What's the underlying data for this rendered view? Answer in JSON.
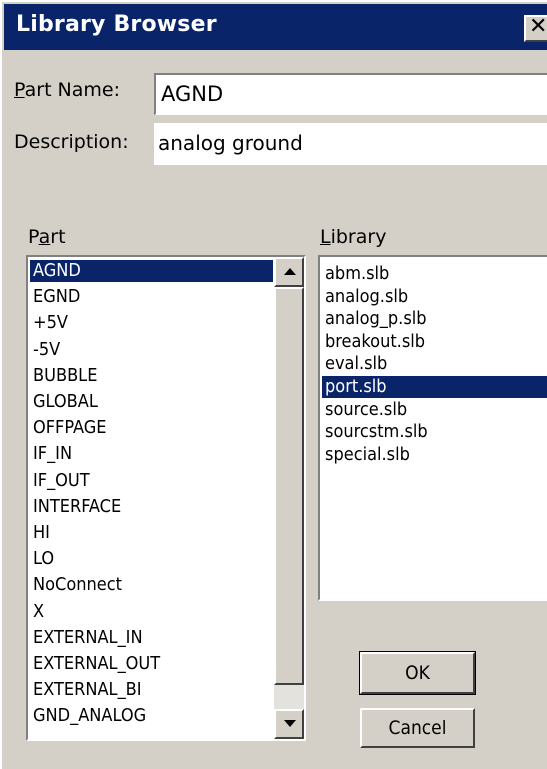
{
  "window": {
    "title": "Library Browser",
    "close_glyph": "✕"
  },
  "form": {
    "part_name_label": "Part Name:",
    "part_name_value": "AGND",
    "description_label": "Description:",
    "description_value": "analog ground"
  },
  "part": {
    "label": "Part",
    "items": [
      "AGND",
      "EGND",
      "+5V",
      "-5V",
      "BUBBLE",
      "GLOBAL",
      "OFFPAGE",
      "IF_IN",
      "IF_OUT",
      "INTERFACE",
      "HI",
      "LO",
      "NoConnect",
      "X",
      "EXTERNAL_IN",
      "EXTERNAL_OUT",
      "EXTERNAL_BI",
      "GND_ANALOG"
    ],
    "selected": "AGND"
  },
  "library": {
    "label": "Library",
    "items": [
      "abm.slb",
      "analog.slb",
      "analog_p.slb",
      "breakout.slb",
      "eval.slb",
      "port.slb",
      "source.slb",
      "sourcstm.slb",
      "special.slb"
    ],
    "selected": "port.slb"
  },
  "buttons": {
    "ok": "OK",
    "cancel": "Cancel"
  },
  "colors": {
    "selection": "#0a246a",
    "face": "#d4d0c8"
  }
}
